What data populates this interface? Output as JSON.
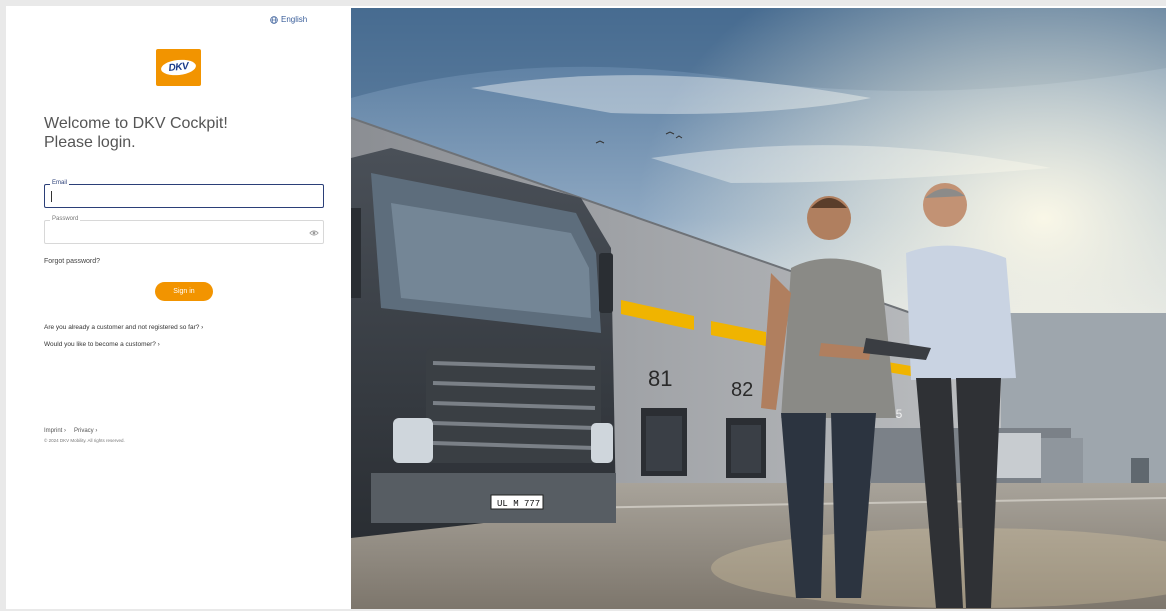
{
  "header": {
    "language_label": "English"
  },
  "brand": {
    "logo_text": "DKV",
    "accent_color": "#f29400",
    "logo_text_color": "#1a3b8a"
  },
  "login": {
    "welcome_line1": "Welcome to DKV Cockpit!",
    "welcome_line2": "Please login.",
    "email_label": "Email",
    "email_value": "",
    "password_label": "Password",
    "password_value": "",
    "forgot_password": "Forgot password?",
    "sign_in_label": "Sign in",
    "registered_link": "Are you already a customer and not registered so far? ›",
    "become_customer_link": "Would you like to become a customer? ›",
    "field_focus_color": "#2b3f78"
  },
  "footer": {
    "imprint": "Imprint ›",
    "privacy": "Privacy ›",
    "copyright": "© 2024 DKV Mobility. All rights reserved."
  },
  "hero": {
    "dock_numbers": [
      "81",
      "82",
      "85"
    ],
    "license_plate": "UL M 777",
    "icons": [
      "globe-icon",
      "eye-icon"
    ]
  }
}
